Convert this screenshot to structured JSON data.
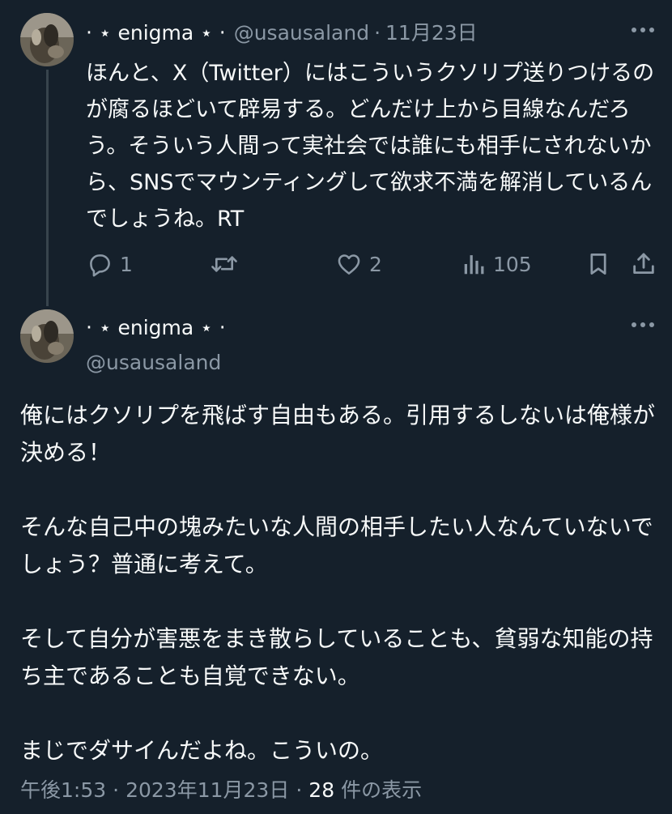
{
  "colors": {
    "background": "#15202b",
    "text_primary": "#f7f9f9",
    "text_secondary": "#8b98a5",
    "thread_line": "#38444d"
  },
  "post1": {
    "display_name": "‧ ⋆ enigma ⋆ ‧",
    "handle": "@usausaland",
    "separator": "·",
    "date": "11月23日",
    "text": "ほんと、X（Twitter）にはこういうクソリプ送りつけるのが腐るほどいて辟易する。どんだけ上から目線なんだろう。そういう人間って実社会では誰にも相手にされないから、SNSでマウンティングして欲求不満を解消しているんでしょうね。RT",
    "actions": {
      "reply_count": "1",
      "repost_count": "",
      "like_count": "2",
      "view_count": "105"
    },
    "icons": [
      "more-icon",
      "reply-icon",
      "repost-icon",
      "like-icon",
      "views-icon",
      "bookmark-icon",
      "share-icon"
    ]
  },
  "post2": {
    "display_name": "‧ ⋆ enigma ⋆ ‧",
    "handle": "@usausaland",
    "paragraphs": [
      "俺にはクソリプを飛ばす自由もある。引用するしないは俺様が決める！",
      "そんな自己中の塊みたいな人間の相手したい人なんていないでしょう？普通に考えて。",
      "そして自分が害悪をまき散らしていることも、貧弱な知能の持ち主であることも自覚できない。",
      "まじでダサイんだよね。こういの。"
    ],
    "meta": {
      "time": "午後1:53",
      "separator": "·",
      "date": "2023年11月23日",
      "views_count": "28",
      "views_label": "件の表示"
    }
  }
}
